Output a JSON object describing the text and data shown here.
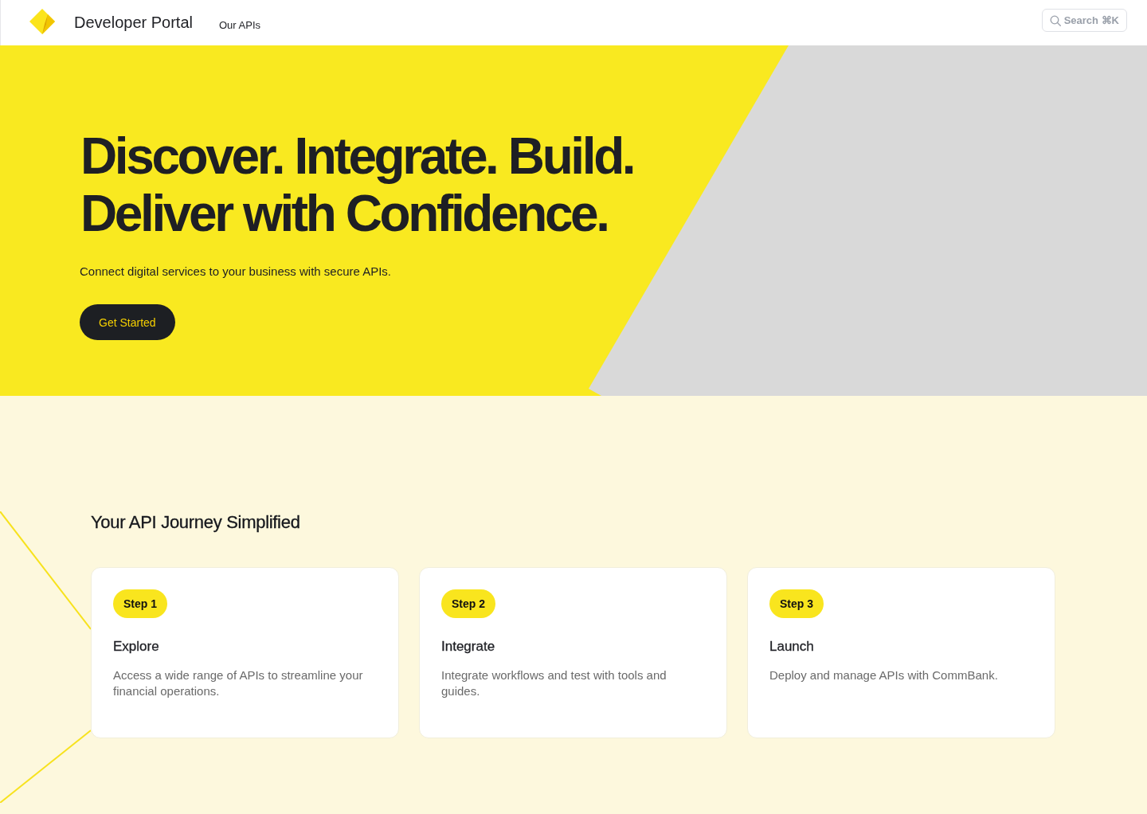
{
  "header": {
    "brand": "Developer Portal",
    "nav": [
      {
        "label": "Our APIs"
      }
    ],
    "search": {
      "label": "Search ⌘K"
    }
  },
  "hero": {
    "title_lines": [
      "Discover. Integrate. Build.",
      "Deliver with Confidence."
    ],
    "subtitle": "Connect digital services to your business with secure APIs.",
    "button": "Get Started"
  },
  "journey": {
    "title": "Your API Journey Simplified",
    "steps": [
      {
        "badge": "Step 1",
        "title": "Explore",
        "description": "Access a wide range of APIs to streamline your financial operations."
      },
      {
        "badge": "Step 2",
        "title": "Integrate",
        "description": "Integrate workflows and test with tools and guides."
      },
      {
        "badge": "Step 3",
        "title": "Launch",
        "description": "Deploy and manage APIs with CommBank."
      }
    ]
  }
}
